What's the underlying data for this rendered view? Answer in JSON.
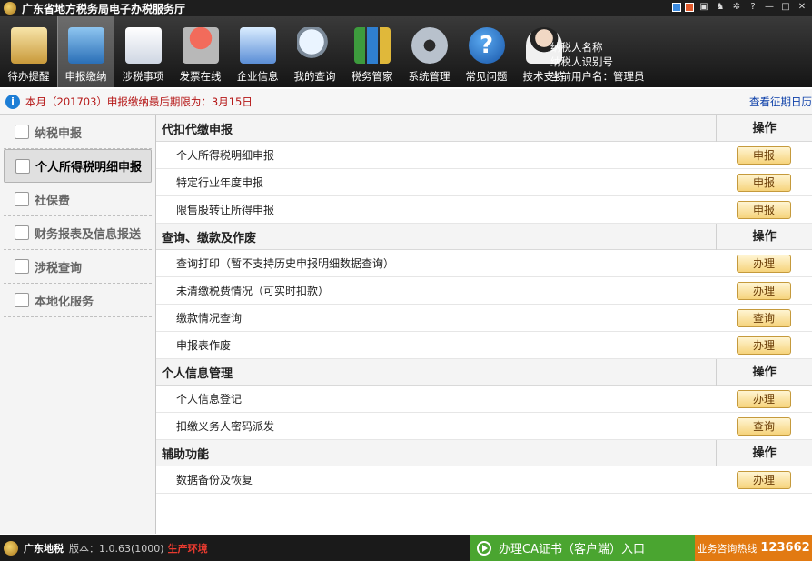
{
  "window": {
    "title": "广东省地方税务局电子办税服务厅"
  },
  "toolbar": {
    "items": [
      {
        "label": "待办提醒",
        "icon": "clipboard-icon"
      },
      {
        "label": "申报缴纳",
        "icon": "monitor-icon"
      },
      {
        "label": "涉税事项",
        "icon": "document-arrow-icon"
      },
      {
        "label": "发票在线",
        "icon": "stamp-icon"
      },
      {
        "label": "企业信息",
        "icon": "building-icon"
      },
      {
        "label": "我的查询",
        "icon": "magnifier-icon"
      },
      {
        "label": "税务管家",
        "icon": "bar-chart-icon"
      },
      {
        "label": "系统管理",
        "icon": "gear-icon"
      },
      {
        "label": "常见问题",
        "icon": "question-icon"
      },
      {
        "label": "技术支持",
        "icon": "headset-person-icon"
      }
    ],
    "user": {
      "taxpayer_name": "纳税人名称",
      "taxpayer_id": "纳税人识别号",
      "current_user": "当前用户名：管理员"
    }
  },
  "notice": {
    "prefix": "本月（",
    "month": "201703",
    "text": "）申报缴纳最后期限为：",
    "deadline": "3月15日",
    "link": "查看征期日历"
  },
  "sidebar": {
    "items": [
      {
        "label": "纳税申报"
      },
      {
        "label": "个人所得税明细申报"
      },
      {
        "label": "社保费"
      },
      {
        "label": "财务报表及信息报送"
      },
      {
        "label": "涉税查询"
      },
      {
        "label": "本地化服务"
      }
    ]
  },
  "content": {
    "op_header": "操作",
    "sections": [
      {
        "title": "代扣代缴申报",
        "rows": [
          {
            "label": "个人所得税明细申报",
            "action": "申报"
          },
          {
            "label": "特定行业年度申报",
            "action": "申报"
          },
          {
            "label": "限售股转让所得申报",
            "action": "申报"
          }
        ]
      },
      {
        "title": "查询、缴款及作废",
        "rows": [
          {
            "label": "查询打印（暂不支持历史申报明细数据查询）",
            "action": "办理"
          },
          {
            "label": "未清缴税费情况（可实时扣款）",
            "action": "办理"
          },
          {
            "label": "缴款情况查询",
            "action": "查询"
          },
          {
            "label": "申报表作废",
            "action": "办理"
          }
        ]
      },
      {
        "title": "个人信息管理",
        "rows": [
          {
            "label": "个人信息登记",
            "action": "办理"
          },
          {
            "label": "扣缴义务人密码派发",
            "action": "查询"
          }
        ]
      },
      {
        "title": "辅助功能",
        "rows": [
          {
            "label": "数据备份及恢复",
            "action": "办理"
          }
        ]
      }
    ]
  },
  "statusbar": {
    "name": "广东地税",
    "version": "版本：1.0.63(1000)",
    "env": "生产环境",
    "ca_button": "办理CA证书（客户端）入口",
    "hotline_label": "业务咨询热线",
    "hotline_number": "123662"
  }
}
